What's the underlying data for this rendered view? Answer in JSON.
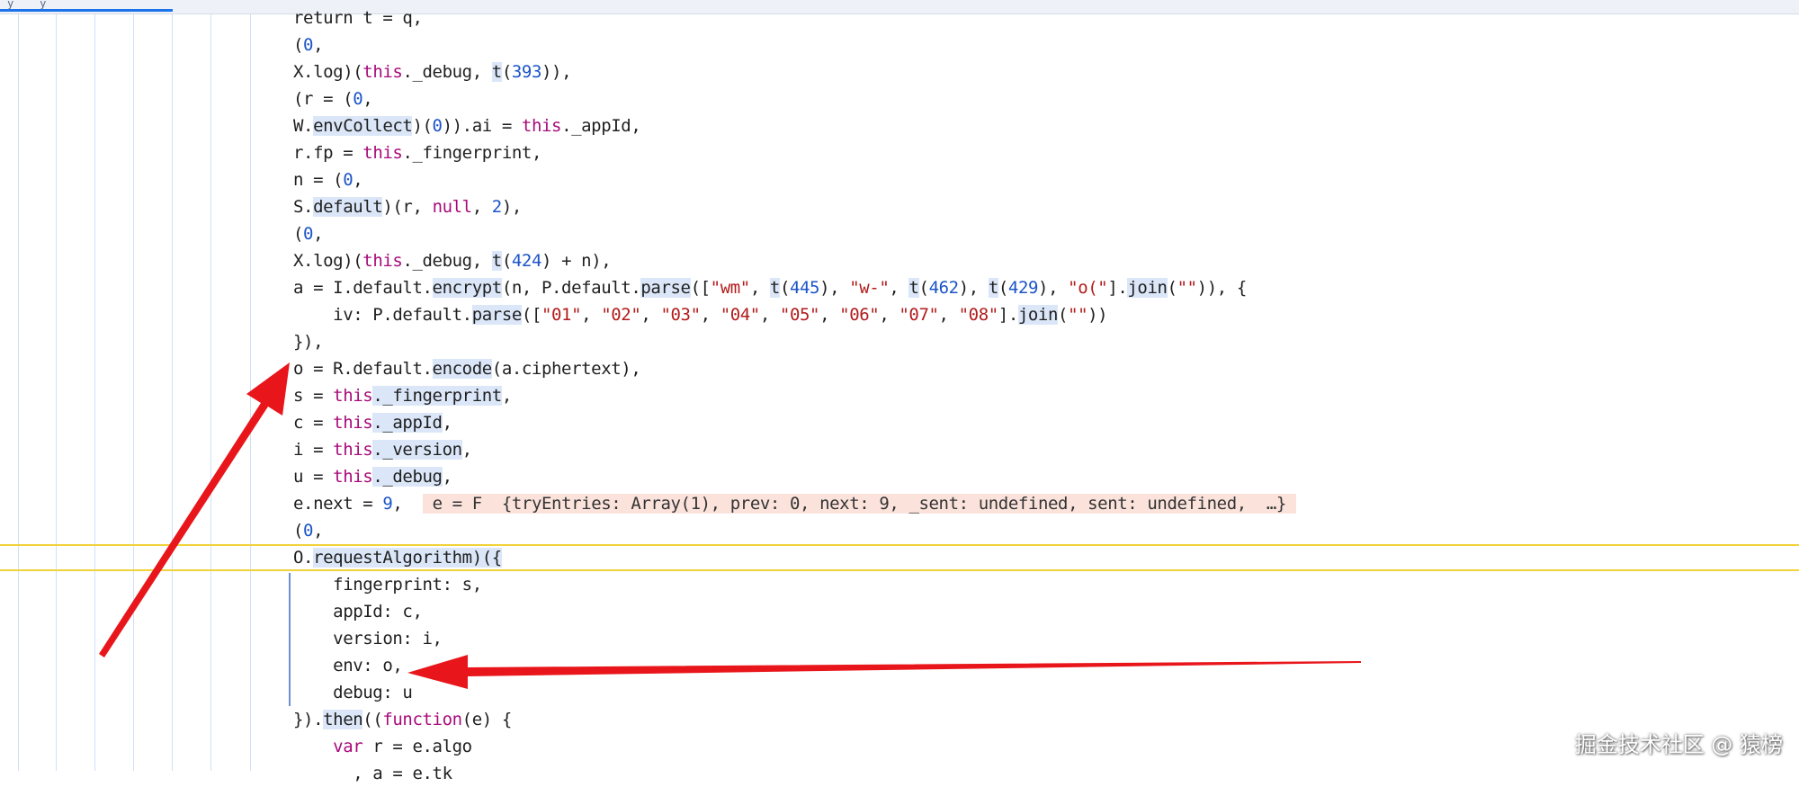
{
  "tab": {
    "label": "y_ _ y"
  },
  "colors": {
    "keyword": "#a80a7a",
    "number": "#1c54c8",
    "string": "#b31b1b",
    "arrow": "#e8161b",
    "highlight_line": "#f2d23a"
  },
  "code": {
    "l01": {
      "a": "return t = q,"
    },
    "l02": {
      "a": "(",
      "b": "0",
      "c": ","
    },
    "l03": {
      "a": "X.log)(",
      "kw": "this",
      "b": "._debug, ",
      "fn": "t",
      "c": "(",
      "n": "393",
      "d": ")),"
    },
    "l04": {
      "a": "(r = (",
      "n": "0",
      "b": ","
    },
    "l05": {
      "a": "W.",
      "fn": "envCollect",
      "b": ")(",
      "n": "0",
      "c": ")).ai = ",
      "kw": "this",
      "d": "._appId,"
    },
    "l06": {
      "a": "r.fp = ",
      "kw": "this",
      "b": "._fingerprint,"
    },
    "l07": {
      "a": "n = (",
      "n": "0",
      "b": ","
    },
    "l08": {
      "a": "S.",
      "fn": "default",
      "b": ")(r, ",
      "kw": "null",
      "c": ", ",
      "n": "2",
      "d": "),"
    },
    "l09": {
      "a": "(",
      "n": "0",
      "b": ","
    },
    "l10": {
      "a": "X.log)(",
      "kw": "this",
      "b": "._debug, ",
      "fn": "t",
      "c": "(",
      "n": "424",
      "d": ") + n),"
    },
    "l11": {
      "a": "a = I.default.",
      "fn1": "encrypt",
      "b": "(n, P.default.",
      "fn2": "parse",
      "c": "([",
      "s1": "\"wm\"",
      "d": ", ",
      "fn3": "t",
      "e": "(",
      "n1": "445",
      "f": "), ",
      "s2": "\"w-\"",
      "g": ", ",
      "fn4": "t",
      "h": "(",
      "n2": "462",
      "i": "), ",
      "fn5": "t",
      "j": "(",
      "n3": "429",
      "k": "), ",
      "s3": "\"o(\"",
      "l": "].",
      "fn6": "join",
      "m": "(",
      "s4": "\"\"",
      "o": ")), {"
    },
    "l12": {
      "a": "    iv: P.default.",
      "fn": "parse",
      "b": "([",
      "s1": "\"01\"",
      "c1": ", ",
      "s2": "\"02\"",
      "c2": ", ",
      "s3": "\"03\"",
      "c3": ", ",
      "s4": "\"04\"",
      "c4": ", ",
      "s5": "\"05\"",
      "c5": ", ",
      "s6": "\"06\"",
      "c6": ", ",
      "s7": "\"07\"",
      "c7": ", ",
      "s8": "\"08\"",
      "d": "].",
      "fn2": "join",
      "e": "(",
      "s9": "\"\"",
      "f": "))"
    },
    "l13": {
      "a": "}),"
    },
    "l14": {
      "a": "o = R.default.",
      "fn": "encode",
      "b": "(a.ciphertext),"
    },
    "l15": {
      "a": "s = ",
      "kw": "this",
      "fn": "._fingerprint",
      "b": ","
    },
    "l16": {
      "a": "c = ",
      "kw": "this",
      "fn": "._appId",
      "b": ","
    },
    "l17": {
      "a": "i = ",
      "kw": "this",
      "fn": "._version",
      "b": ","
    },
    "l18": {
      "a": "u = ",
      "kw": "this",
      "fn": "._debug",
      "b": ","
    },
    "l19": {
      "a": "e.next = ",
      "n": "9",
      "b": ",  ",
      "inline": " e = F  {tryEntries: Array(1), prev: 0, next: 9, _sent: undefined, sent: undefined,  …} "
    },
    "l20": {
      "a": "(",
      "n": "0",
      "b": ","
    },
    "l21": {
      "a": "O.",
      "fn": "requestAlgorithm",
      "b": ")({"
    },
    "l22": {
      "a": "    fingerprint: s,"
    },
    "l23": {
      "a": "    appId: c,"
    },
    "l24": {
      "a": "    version: i,"
    },
    "l25": {
      "a": "    env: o,"
    },
    "l26": {
      "a": "    debug: u"
    },
    "l27": {
      "a": "}).",
      "fn": "then",
      "b": "((",
      "kw": "function",
      "c": "(e) {"
    },
    "l28": {
      "a": "    ",
      "kw": "var",
      "b": " r = e.algo"
    },
    "l29": {
      "a": "      , a = e.tk"
    }
  },
  "watermark": {
    "text": "掘金技术社区 @ 猿榜"
  }
}
